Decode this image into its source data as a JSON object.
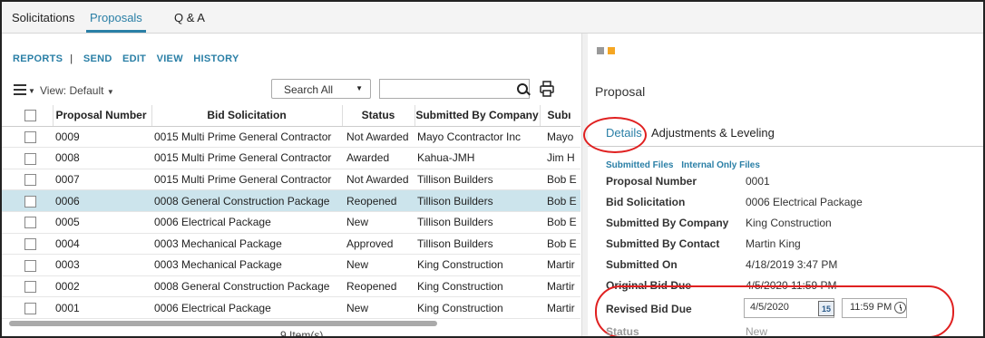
{
  "top_tabs": [
    "Solicitations",
    "Proposals",
    "Q & A"
  ],
  "actions": {
    "reports": "REPORTS",
    "separator": "|",
    "send": "SEND",
    "edit": "EDIT",
    "view": "VIEW",
    "history": "HISTORY"
  },
  "toolbar": {
    "view_label": "View: Default",
    "search_scope": "Search All",
    "search_value": ""
  },
  "table": {
    "columns": [
      "Proposal Number",
      "Bid Solicitation",
      "Status",
      "Submitted By Company",
      "Subı"
    ],
    "rows": [
      [
        "0009",
        "0015 Multi Prime General Contractor",
        "Not Awarded",
        "Mayo Ccontractor Inc",
        "Mayo"
      ],
      [
        "0008",
        "0015 Multi Prime General Contractor",
        "Awarded",
        "Kahua-JMH",
        "Jim H"
      ],
      [
        "0007",
        "0015 Multi Prime General Contractor",
        "Not Awarded",
        "Tillison Builders",
        "Bob E"
      ],
      [
        "0006",
        "0008 General Construction Package",
        "Reopened",
        "Tillison Builders",
        "Bob E"
      ],
      [
        "0005",
        "0006 Electrical Package",
        "New",
        "Tillison Builders",
        "Bob E"
      ],
      [
        "0004",
        "0003 Mechanical Package",
        "Approved",
        "Tillison Builders",
        "Bob E"
      ],
      [
        "0003",
        "0003 Mechanical Package",
        "New",
        "King Construction",
        "Martir"
      ],
      [
        "0002",
        "0008 General Construction Package",
        "Reopened",
        "King Construction",
        "Martir"
      ],
      [
        "0001",
        "0006 Electrical Package",
        "New",
        "King Construction",
        "Martir"
      ]
    ],
    "selected_row": 3,
    "item_count": "9 Item(s)"
  },
  "detail": {
    "title": "Proposal",
    "tabs": [
      "Details",
      "Adjustments & Leveling"
    ],
    "links": [
      "Submitted Files",
      "Internal Only Files"
    ],
    "fields": [
      {
        "label": "Proposal Number",
        "value": "0001"
      },
      {
        "label": "Bid Solicitation",
        "value": "0006 Electrical Package"
      },
      {
        "label": "Submitted By Company",
        "value": "King Construction"
      },
      {
        "label": "Submitted By Contact",
        "value": "Martin King"
      },
      {
        "label": "Submitted On",
        "value": "4/18/2019 3:47 PM"
      },
      {
        "label": "Original Bid Due",
        "value": "4/5/2020 11:59 PM"
      }
    ],
    "revised_label": "Revised Bid Due",
    "revised_date": "4/5/2020",
    "revised_time": "11:59 PM",
    "calendar_day": "15",
    "status_label": "Status",
    "status_value": "New"
  },
  "colors": {
    "accent": "#2a7fa6",
    "selected_row": "#cce4ec",
    "highlight": "#e02020",
    "orange": "#f5a623"
  }
}
